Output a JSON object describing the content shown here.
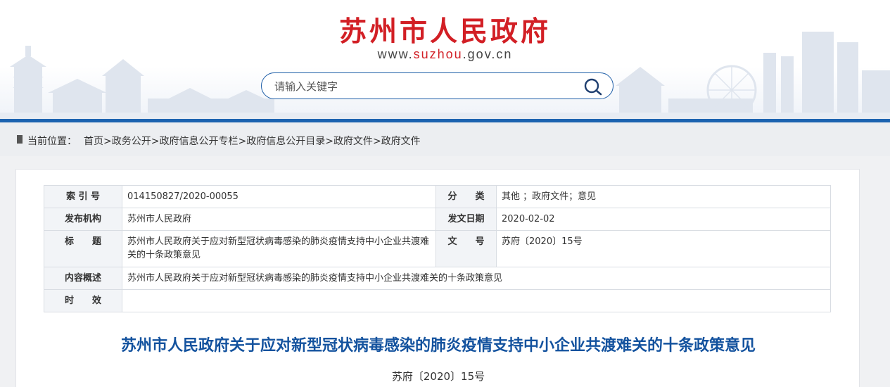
{
  "header": {
    "site_title": "苏州市人民政府",
    "site_url_prefix": "www.",
    "site_url_domain": "suzhou",
    "site_url_suffix": ".gov.cn",
    "brand_color": "#d21f25",
    "accent_color": "#1c63b0"
  },
  "search": {
    "placeholder": "请输入关键字",
    "icon": "search-icon"
  },
  "breadcrumb": {
    "label": "当前位置：",
    "items": [
      "首页",
      "政务公开",
      "政府信息公开专栏",
      "政府信息公开目录",
      "政府文件",
      "政府文件"
    ],
    "separator": ">"
  },
  "meta_table": {
    "index_label": "索 引 号",
    "index_value": "014150827/2020-00055",
    "category_label": "分　　类",
    "category_value": "其他 ；政府文件；意见",
    "issuer_label": "发布机构",
    "issuer_value": "苏州市人民政府",
    "date_label": "发文日期",
    "date_value": "2020-02-02",
    "title_label": "标　　题",
    "title_value": "苏州市人民政府关于应对新型冠状病毒感染的肺炎疫情支持中小企业共渡难关的十条政策意见",
    "docno_label": "文　　号",
    "docno_value": "苏府〔2020〕15号",
    "summary_label": "内容概述",
    "summary_value": "苏州市人民政府关于应对新型冠状病毒感染的肺炎疫情支持中小企业共渡难关的十条政策意见",
    "validity_label": "时　　效",
    "validity_value": ""
  },
  "document": {
    "title": "苏州市人民政府关于应对新型冠状病毒感染的肺炎疫情支持中小企业共渡难关的十条政策意见",
    "number": "苏府〔2020〕15号",
    "title_color": "#13529e"
  }
}
